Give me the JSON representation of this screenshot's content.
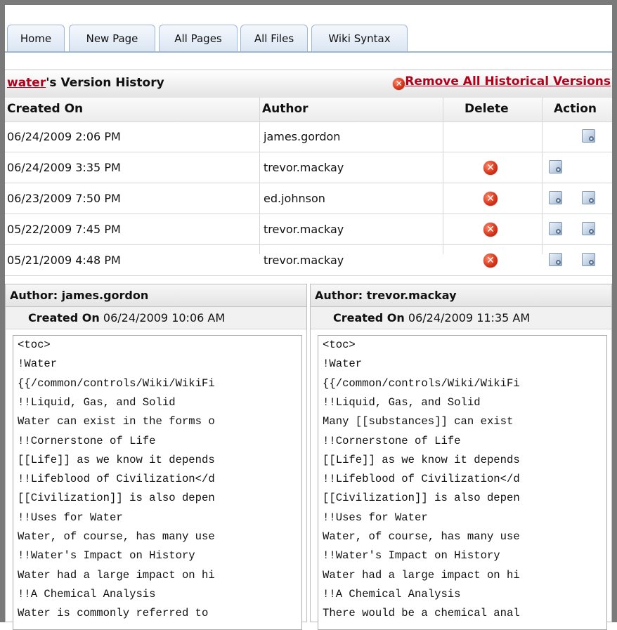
{
  "tabs": [
    {
      "label": "Home"
    },
    {
      "label": "New Page"
    },
    {
      "label": "All Pages"
    },
    {
      "label": "All Files"
    },
    {
      "label": "Wiki Syntax"
    }
  ],
  "history": {
    "page_link": "water",
    "title_suffix": "'s Version History",
    "remove_all_label": "Remove All Historical Versions",
    "columns": {
      "created_on": "Created On",
      "author": "Author",
      "delete": "Delete",
      "action": "Action"
    },
    "rows": [
      {
        "created_on": "06/24/2009 2:06 PM",
        "author": "james.gordon",
        "deletable": false,
        "actions": [
          "right"
        ]
      },
      {
        "created_on": "06/24/2009 3:35 PM",
        "author": "trevor.mackay",
        "deletable": true,
        "actions": [
          "left"
        ]
      },
      {
        "created_on": "06/23/2009 7:50 PM",
        "author": "ed.johnson",
        "deletable": true,
        "actions": [
          "left",
          "right"
        ]
      },
      {
        "created_on": "05/22/2009 7:45 PM",
        "author": "trevor.mackay",
        "deletable": true,
        "actions": [
          "left",
          "right"
        ]
      },
      {
        "created_on": "05/21/2009 4:48 PM",
        "author": "trevor.mackay",
        "deletable": true,
        "actions": [
          "left",
          "right"
        ]
      }
    ]
  },
  "compare": {
    "left": {
      "author_label": "Author: james.gordon",
      "created_label": "Created On",
      "created_value": "06/24/2009 10:06 AM",
      "lines": [
        "<toc>",
        "!Water",
        "{{/common/controls/Wiki/WikiFi",
        "!!Liquid, Gas, and Solid",
        "Water can exist in the forms o",
        "!!Cornerstone of Life",
        "[[Life]] as we know it depends",
        "!!Lifeblood of Civilization</d",
        "[[Civilization]] is also depen",
        "!!Uses for Water",
        "Water, of course, has many use",
        "!!Water's Impact on History",
        "Water had a large impact on hi",
        "!!A Chemical Analysis",
        "Water is commonly referred to"
      ]
    },
    "right": {
      "author_label": "Author: trevor.mackay",
      "created_label": "Created On",
      "created_value": "06/24/2009 11:35 AM",
      "lines": [
        "<toc>",
        "!Water",
        "{{/common/controls/Wiki/WikiFi",
        "!!Liquid, Gas, and Solid",
        "Many [[substances]] can exist",
        "!!Cornerstone of Life",
        "[[Life]] as we know it depends",
        "!!Lifeblood of Civilization</d",
        "[[Civilization]] is also depen",
        "!!Uses for Water",
        "Water, of course, has many use",
        "!!Water's Impact on History",
        "Water had a large impact on hi",
        "!!A Chemical Analysis",
        "There would be a chemical anal"
      ]
    }
  },
  "colors": {
    "link_red": "#b3001b",
    "tab_border": "#9cb6d4",
    "frame": "#7a7a7a"
  },
  "icons": {
    "delete": "red-x-circle-icon",
    "view": "view-version-icon"
  }
}
